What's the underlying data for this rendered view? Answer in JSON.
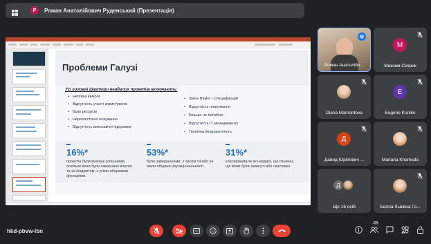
{
  "presenter": {
    "avatar_letter": "Р",
    "avatar_color": "#c2185b",
    "label": "Роман Анатолійович Руденський (Презентація)"
  },
  "slide": {
    "title": "Проблеми Галузі",
    "intro": "Усі головні фактори невдалих проектів включають:",
    "left_bullets": [
      "Неповні вимоги",
      "Відсутність участі користувачів",
      "Брак ресурсів",
      "Нереалістичні очікування",
      "Відсутність виконавчої підтримки"
    ],
    "right_bullets": [
      "Зміна Вимог і Специфікацій",
      "Відсутність планування",
      "Більше не потрібно",
      "Відсутність ІТ менеджменту",
      "Технічна безграмотність"
    ],
    "stats": [
      {
        "value": "16%*",
        "text": "проектів були визнані успішними, оскільки вони були завершені вчасно та за бюджетом, з усіма обіцяними функціями."
      },
      {
        "value": "53%*",
        "text": "були завершеними, з часом та/або не мали обіцяної функціональності."
      },
      {
        "value": "31%*",
        "text": "класифікували як невдалі, що означає, що вони були закинуті або скасовані."
      }
    ]
  },
  "participants": [
    {
      "name": "Роман Анатолійо...",
      "type": "video",
      "active": true
    },
    {
      "name": "Максим Скорик",
      "letter": "M",
      "color": "#c2185b"
    },
    {
      "name": "Diana Mamontova",
      "type": "photo"
    },
    {
      "name": "Eugene Kuriiko",
      "letter": "E",
      "color": "#5e35b1"
    },
    {
      "name": "Давид Юрійович ...",
      "letter": "Д",
      "color": "#d84315"
    },
    {
      "name": "Mariana Khamuda",
      "type": "photo"
    },
    {
      "name": "Ще 16 осіб",
      "letter": "Д",
      "color": "#6d6d6d"
    },
    {
      "name": "Белла Львівна Го...",
      "type": "photo"
    }
  ],
  "meeting": {
    "code": "hkd-pbvw-lbn",
    "participant_count": "24"
  },
  "icons": {
    "mic_off": "mic-off-icon",
    "cam_off": "camera-off-icon",
    "captions": "captions-icon",
    "emoji": "emoji-icon",
    "present": "present-icon",
    "hand": "raise-hand-icon",
    "more": "more-options-icon",
    "end": "end-call-icon",
    "info": "info-icon",
    "people": "people-icon",
    "chat": "chat-icon",
    "activities": "activities-icon",
    "lock": "host-controls-icon"
  }
}
